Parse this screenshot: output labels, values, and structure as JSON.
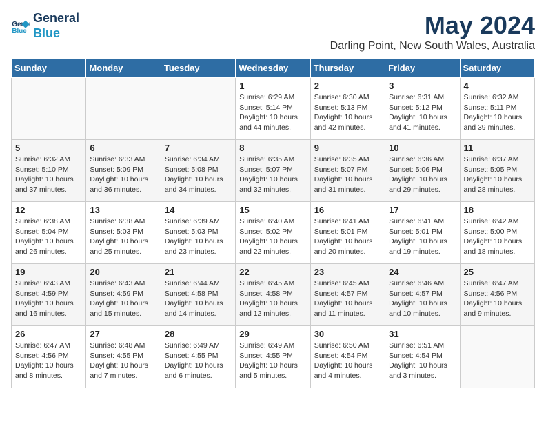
{
  "header": {
    "logo_line1": "General",
    "logo_line2": "Blue",
    "month_year": "May 2024",
    "location": "Darling Point, New South Wales, Australia"
  },
  "weekdays": [
    "Sunday",
    "Monday",
    "Tuesday",
    "Wednesday",
    "Thursday",
    "Friday",
    "Saturday"
  ],
  "weeks": [
    [
      {
        "day": "",
        "info": ""
      },
      {
        "day": "",
        "info": ""
      },
      {
        "day": "",
        "info": ""
      },
      {
        "day": "1",
        "info": "Sunrise: 6:29 AM\nSunset: 5:14 PM\nDaylight: 10 hours\nand 44 minutes."
      },
      {
        "day": "2",
        "info": "Sunrise: 6:30 AM\nSunset: 5:13 PM\nDaylight: 10 hours\nand 42 minutes."
      },
      {
        "day": "3",
        "info": "Sunrise: 6:31 AM\nSunset: 5:12 PM\nDaylight: 10 hours\nand 41 minutes."
      },
      {
        "day": "4",
        "info": "Sunrise: 6:32 AM\nSunset: 5:11 PM\nDaylight: 10 hours\nand 39 minutes."
      }
    ],
    [
      {
        "day": "5",
        "info": "Sunrise: 6:32 AM\nSunset: 5:10 PM\nDaylight: 10 hours\nand 37 minutes."
      },
      {
        "day": "6",
        "info": "Sunrise: 6:33 AM\nSunset: 5:09 PM\nDaylight: 10 hours\nand 36 minutes."
      },
      {
        "day": "7",
        "info": "Sunrise: 6:34 AM\nSunset: 5:08 PM\nDaylight: 10 hours\nand 34 minutes."
      },
      {
        "day": "8",
        "info": "Sunrise: 6:35 AM\nSunset: 5:07 PM\nDaylight: 10 hours\nand 32 minutes."
      },
      {
        "day": "9",
        "info": "Sunrise: 6:35 AM\nSunset: 5:07 PM\nDaylight: 10 hours\nand 31 minutes."
      },
      {
        "day": "10",
        "info": "Sunrise: 6:36 AM\nSunset: 5:06 PM\nDaylight: 10 hours\nand 29 minutes."
      },
      {
        "day": "11",
        "info": "Sunrise: 6:37 AM\nSunset: 5:05 PM\nDaylight: 10 hours\nand 28 minutes."
      }
    ],
    [
      {
        "day": "12",
        "info": "Sunrise: 6:38 AM\nSunset: 5:04 PM\nDaylight: 10 hours\nand 26 minutes."
      },
      {
        "day": "13",
        "info": "Sunrise: 6:38 AM\nSunset: 5:03 PM\nDaylight: 10 hours\nand 25 minutes."
      },
      {
        "day": "14",
        "info": "Sunrise: 6:39 AM\nSunset: 5:03 PM\nDaylight: 10 hours\nand 23 minutes."
      },
      {
        "day": "15",
        "info": "Sunrise: 6:40 AM\nSunset: 5:02 PM\nDaylight: 10 hours\nand 22 minutes."
      },
      {
        "day": "16",
        "info": "Sunrise: 6:41 AM\nSunset: 5:01 PM\nDaylight: 10 hours\nand 20 minutes."
      },
      {
        "day": "17",
        "info": "Sunrise: 6:41 AM\nSunset: 5:01 PM\nDaylight: 10 hours\nand 19 minutes."
      },
      {
        "day": "18",
        "info": "Sunrise: 6:42 AM\nSunset: 5:00 PM\nDaylight: 10 hours\nand 18 minutes."
      }
    ],
    [
      {
        "day": "19",
        "info": "Sunrise: 6:43 AM\nSunset: 4:59 PM\nDaylight: 10 hours\nand 16 minutes."
      },
      {
        "day": "20",
        "info": "Sunrise: 6:43 AM\nSunset: 4:59 PM\nDaylight: 10 hours\nand 15 minutes."
      },
      {
        "day": "21",
        "info": "Sunrise: 6:44 AM\nSunset: 4:58 PM\nDaylight: 10 hours\nand 14 minutes."
      },
      {
        "day": "22",
        "info": "Sunrise: 6:45 AM\nSunset: 4:58 PM\nDaylight: 10 hours\nand 12 minutes."
      },
      {
        "day": "23",
        "info": "Sunrise: 6:45 AM\nSunset: 4:57 PM\nDaylight: 10 hours\nand 11 minutes."
      },
      {
        "day": "24",
        "info": "Sunrise: 6:46 AM\nSunset: 4:57 PM\nDaylight: 10 hours\nand 10 minutes."
      },
      {
        "day": "25",
        "info": "Sunrise: 6:47 AM\nSunset: 4:56 PM\nDaylight: 10 hours\nand 9 minutes."
      }
    ],
    [
      {
        "day": "26",
        "info": "Sunrise: 6:47 AM\nSunset: 4:56 PM\nDaylight: 10 hours\nand 8 minutes."
      },
      {
        "day": "27",
        "info": "Sunrise: 6:48 AM\nSunset: 4:55 PM\nDaylight: 10 hours\nand 7 minutes."
      },
      {
        "day": "28",
        "info": "Sunrise: 6:49 AM\nSunset: 4:55 PM\nDaylight: 10 hours\nand 6 minutes."
      },
      {
        "day": "29",
        "info": "Sunrise: 6:49 AM\nSunset: 4:55 PM\nDaylight: 10 hours\nand 5 minutes."
      },
      {
        "day": "30",
        "info": "Sunrise: 6:50 AM\nSunset: 4:54 PM\nDaylight: 10 hours\nand 4 minutes."
      },
      {
        "day": "31",
        "info": "Sunrise: 6:51 AM\nSunset: 4:54 PM\nDaylight: 10 hours\nand 3 minutes."
      },
      {
        "day": "",
        "info": ""
      }
    ]
  ]
}
